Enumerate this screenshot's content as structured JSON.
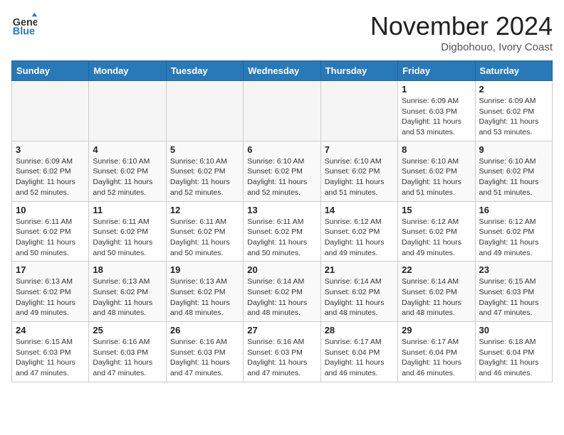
{
  "header": {
    "logo_general": "General",
    "logo_blue": "Blue",
    "month": "November 2024",
    "location": "Digbohouo, Ivory Coast"
  },
  "weekdays": [
    "Sunday",
    "Monday",
    "Tuesday",
    "Wednesday",
    "Thursday",
    "Friday",
    "Saturday"
  ],
  "weeks": [
    [
      {
        "day": "",
        "info": ""
      },
      {
        "day": "",
        "info": ""
      },
      {
        "day": "",
        "info": ""
      },
      {
        "day": "",
        "info": ""
      },
      {
        "day": "",
        "info": ""
      },
      {
        "day": "1",
        "info": "Sunrise: 6:09 AM\nSunset: 6:03 PM\nDaylight: 11 hours\nand 53 minutes."
      },
      {
        "day": "2",
        "info": "Sunrise: 6:09 AM\nSunset: 6:02 PM\nDaylight: 11 hours\nand 53 minutes."
      }
    ],
    [
      {
        "day": "3",
        "info": "Sunrise: 6:09 AM\nSunset: 6:02 PM\nDaylight: 11 hours\nand 52 minutes."
      },
      {
        "day": "4",
        "info": "Sunrise: 6:10 AM\nSunset: 6:02 PM\nDaylight: 11 hours\nand 52 minutes."
      },
      {
        "day": "5",
        "info": "Sunrise: 6:10 AM\nSunset: 6:02 PM\nDaylight: 11 hours\nand 52 minutes."
      },
      {
        "day": "6",
        "info": "Sunrise: 6:10 AM\nSunset: 6:02 PM\nDaylight: 11 hours\nand 52 minutes."
      },
      {
        "day": "7",
        "info": "Sunrise: 6:10 AM\nSunset: 6:02 PM\nDaylight: 11 hours\nand 51 minutes."
      },
      {
        "day": "8",
        "info": "Sunrise: 6:10 AM\nSunset: 6:02 PM\nDaylight: 11 hours\nand 51 minutes."
      },
      {
        "day": "9",
        "info": "Sunrise: 6:10 AM\nSunset: 6:02 PM\nDaylight: 11 hours\nand 51 minutes."
      }
    ],
    [
      {
        "day": "10",
        "info": "Sunrise: 6:11 AM\nSunset: 6:02 PM\nDaylight: 11 hours\nand 50 minutes."
      },
      {
        "day": "11",
        "info": "Sunrise: 6:11 AM\nSunset: 6:02 PM\nDaylight: 11 hours\nand 50 minutes."
      },
      {
        "day": "12",
        "info": "Sunrise: 6:11 AM\nSunset: 6:02 PM\nDaylight: 11 hours\nand 50 minutes."
      },
      {
        "day": "13",
        "info": "Sunrise: 6:11 AM\nSunset: 6:02 PM\nDaylight: 11 hours\nand 50 minutes."
      },
      {
        "day": "14",
        "info": "Sunrise: 6:12 AM\nSunset: 6:02 PM\nDaylight: 11 hours\nand 49 minutes."
      },
      {
        "day": "15",
        "info": "Sunrise: 6:12 AM\nSunset: 6:02 PM\nDaylight: 11 hours\nand 49 minutes."
      },
      {
        "day": "16",
        "info": "Sunrise: 6:12 AM\nSunset: 6:02 PM\nDaylight: 11 hours\nand 49 minutes."
      }
    ],
    [
      {
        "day": "17",
        "info": "Sunrise: 6:13 AM\nSunset: 6:02 PM\nDaylight: 11 hours\nand 49 minutes."
      },
      {
        "day": "18",
        "info": "Sunrise: 6:13 AM\nSunset: 6:02 PM\nDaylight: 11 hours\nand 48 minutes."
      },
      {
        "day": "19",
        "info": "Sunrise: 6:13 AM\nSunset: 6:02 PM\nDaylight: 11 hours\nand 48 minutes."
      },
      {
        "day": "20",
        "info": "Sunrise: 6:14 AM\nSunset: 6:02 PM\nDaylight: 11 hours\nand 48 minutes."
      },
      {
        "day": "21",
        "info": "Sunrise: 6:14 AM\nSunset: 6:02 PM\nDaylight: 11 hours\nand 48 minutes."
      },
      {
        "day": "22",
        "info": "Sunrise: 6:14 AM\nSunset: 6:02 PM\nDaylight: 11 hours\nand 48 minutes."
      },
      {
        "day": "23",
        "info": "Sunrise: 6:15 AM\nSunset: 6:03 PM\nDaylight: 11 hours\nand 47 minutes."
      }
    ],
    [
      {
        "day": "24",
        "info": "Sunrise: 6:15 AM\nSunset: 6:03 PM\nDaylight: 11 hours\nand 47 minutes."
      },
      {
        "day": "25",
        "info": "Sunrise: 6:16 AM\nSunset: 6:03 PM\nDaylight: 11 hours\nand 47 minutes."
      },
      {
        "day": "26",
        "info": "Sunrise: 6:16 AM\nSunset: 6:03 PM\nDaylight: 11 hours\nand 47 minutes."
      },
      {
        "day": "27",
        "info": "Sunrise: 6:16 AM\nSunset: 6:03 PM\nDaylight: 11 hours\nand 47 minutes."
      },
      {
        "day": "28",
        "info": "Sunrise: 6:17 AM\nSunset: 6:04 PM\nDaylight: 11 hours\nand 46 minutes."
      },
      {
        "day": "29",
        "info": "Sunrise: 6:17 AM\nSunset: 6:04 PM\nDaylight: 11 hours\nand 46 minutes."
      },
      {
        "day": "30",
        "info": "Sunrise: 6:18 AM\nSunset: 6:04 PM\nDaylight: 11 hours\nand 46 minutes."
      }
    ]
  ]
}
